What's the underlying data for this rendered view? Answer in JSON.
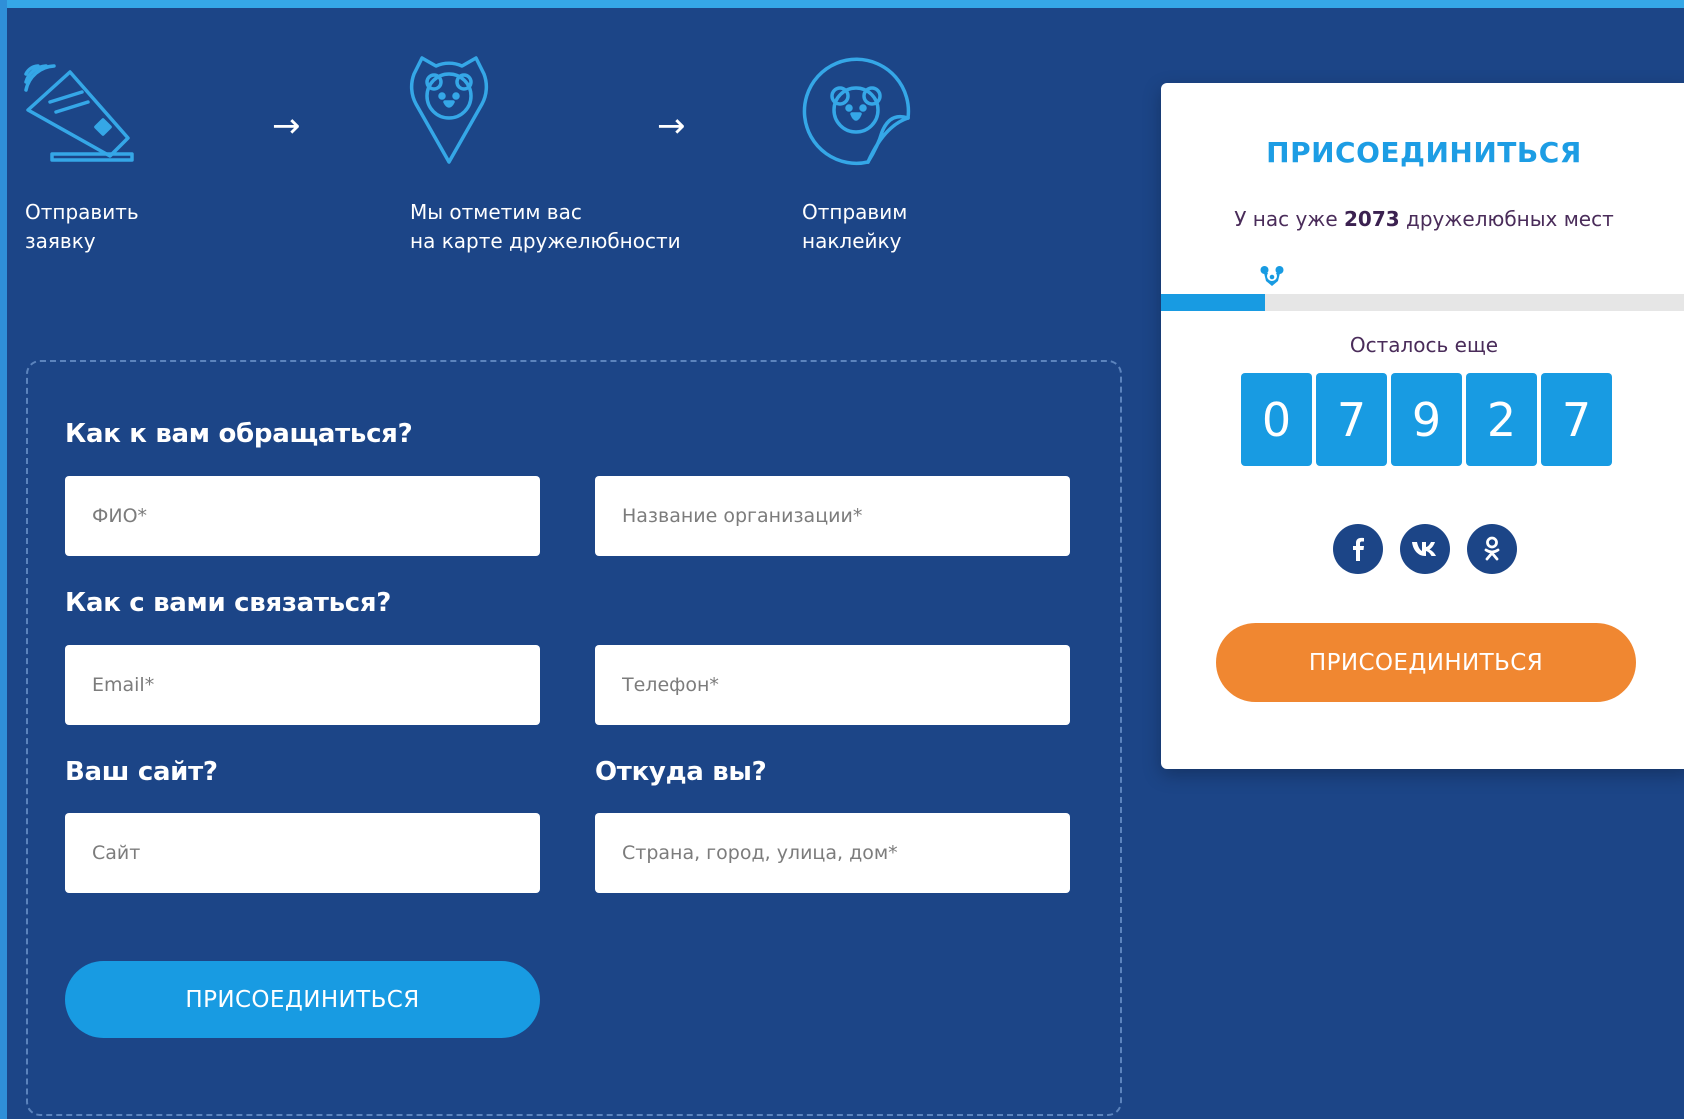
{
  "steps": [
    {
      "icon": "card-tap-icon",
      "text": "Отправить\nзаявку"
    },
    {
      "icon": "koala-map-pin-icon",
      "text": "Мы отметим вас\nна карте дружелюбности"
    },
    {
      "icon": "koala-sticker-icon",
      "text": "Отправим\nнаклейку"
    }
  ],
  "arrows": [
    "→",
    "→"
  ],
  "form": {
    "name_question": "Как к вам обращаться?",
    "contact_question": "Как с вами связаться?",
    "site_question": "Ваш сайт?",
    "location_question": "Откуда вы?",
    "fio_placeholder": "ФИО*",
    "org_placeholder": "Название организации*",
    "email_placeholder": "Email*",
    "phone_placeholder": "Телефон*",
    "site_placeholder": "Сайт",
    "address_placeholder": "Страна, город, улица, дом*",
    "submit_label": "ПРИСОЕДИНИТЬСЯ"
  },
  "card": {
    "title": "ПРИСОЕДИНИТЬСЯ",
    "count_prefix": "У нас уже",
    "count_value": "2073",
    "count_suffix": "дружелюбных мест",
    "progress_fraction": 0.197,
    "remaining_label": "Осталось еще",
    "remaining_digits": [
      "0",
      "7",
      "9",
      "2",
      "7"
    ],
    "socials": [
      {
        "icon": "facebook-icon",
        "glyph": "f"
      },
      {
        "icon": "vk-icon",
        "glyph": "vk"
      },
      {
        "icon": "odnoklassniki-icon",
        "glyph": "ok"
      }
    ],
    "button_label": "ПРИСОЕДИНИТЬСЯ"
  },
  "colors": {
    "background": "#1c4587",
    "accent_blue": "#189be2",
    "accent_orange": "#f08731",
    "icon_line": "#35a7e7"
  }
}
